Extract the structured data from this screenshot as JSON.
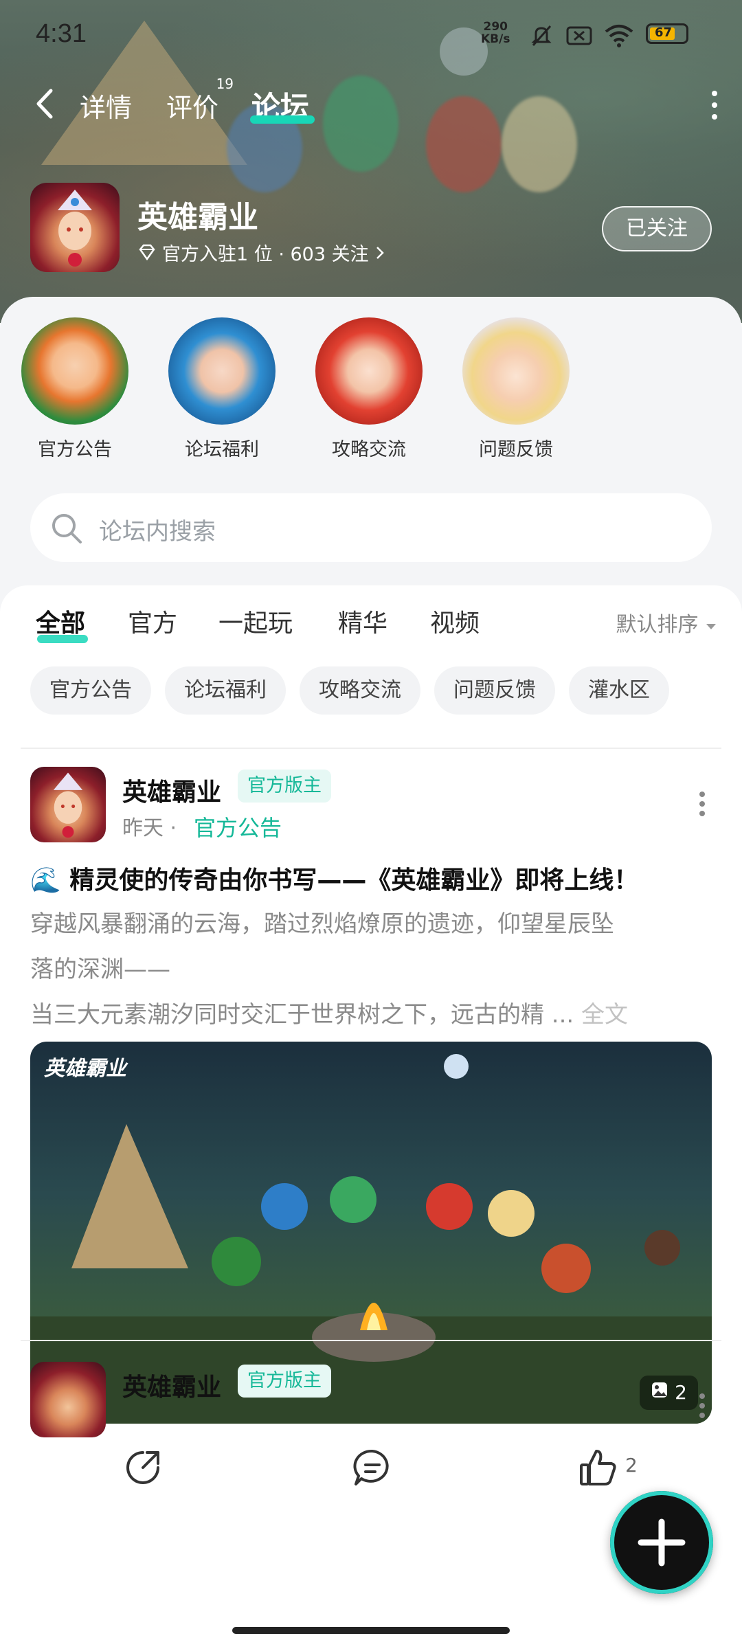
{
  "status_bar": {
    "time": "4:31",
    "net_speed": "290",
    "net_unit": "KB/s",
    "battery": "67"
  },
  "nav": {
    "tabs": [
      {
        "label": "详情"
      },
      {
        "label": "评价",
        "badge": "19"
      },
      {
        "label": "论坛"
      }
    ],
    "active_tab": "论坛"
  },
  "game": {
    "title": "英雄霸业",
    "subtitle": "官方入驻1 位 · 603 关注",
    "follow_label": "已关注"
  },
  "shortcuts": [
    {
      "label": "官方公告"
    },
    {
      "label": "论坛福利"
    },
    {
      "label": "攻略交流"
    },
    {
      "label": "问题反馈"
    }
  ],
  "search": {
    "placeholder": "论坛内搜索"
  },
  "feed_tabs": [
    {
      "label": "全部"
    },
    {
      "label": "官方"
    },
    {
      "label": "一起玩"
    },
    {
      "label": "精华"
    },
    {
      "label": "视频"
    }
  ],
  "sort_label": "默认排序",
  "chips": [
    {
      "label": "官方公告"
    },
    {
      "label": "论坛福利"
    },
    {
      "label": "攻略交流"
    },
    {
      "label": "问题反馈"
    },
    {
      "label": "灌水区"
    }
  ],
  "posts": [
    {
      "author": "英雄霸业",
      "badge": "官方版主",
      "time": "昨天",
      "category": "官方公告",
      "title": "🌊 精灵使的传奇由你书写——《英雄霸业》即将上线！",
      "body_line1": "穿越风暴翻涌的云海，踏过烈焰燎原的遗迹，仰望星辰坠",
      "body_line2": "落的深渊——",
      "body_line3": "当三大元素潮汐同时交汇于世界树之下，远古的精 ...",
      "read_more": "全文",
      "image_logo": "英雄霸业",
      "image_count": "2",
      "like_count": "2"
    },
    {
      "author": "英雄霸业",
      "badge": "官方版主"
    }
  ],
  "colors": {
    "accent": "#18d6b7",
    "badge_bg": "#e6f8f4",
    "badge_text": "#15b898"
  }
}
